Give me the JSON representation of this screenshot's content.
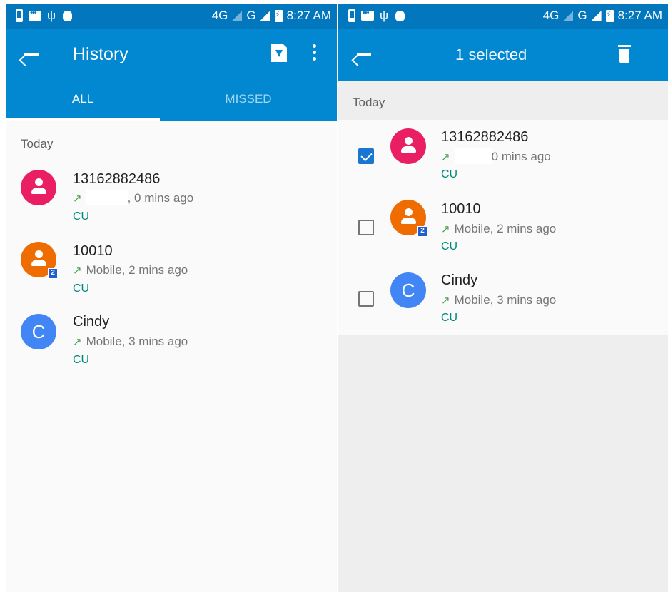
{
  "status_bar": {
    "network": "4G",
    "network2": "G",
    "time": "8:27 AM"
  },
  "left": {
    "title": "History",
    "tabs": [
      {
        "label": "ALL",
        "selected": true
      },
      {
        "label": "MISSED",
        "selected": false
      }
    ],
    "section_header": "Today",
    "entries": [
      {
        "name": "13162882486",
        "detail": ", 0 mins ago",
        "carrier": "CU",
        "avatar": "person",
        "avatar_color": "#e91e63",
        "sim": ""
      },
      {
        "name": "10010",
        "detail": "Mobile, 2 mins ago",
        "carrier": "CU",
        "avatar": "person",
        "avatar_color": "#ef6c00",
        "sim": "2"
      },
      {
        "name": "Cindy",
        "detail": "Mobile, 3 mins ago",
        "carrier": "CU",
        "avatar": "C",
        "avatar_color": "#4285f4",
        "sim": ""
      }
    ]
  },
  "right": {
    "title": "1 selected",
    "section_header": "Today",
    "entries": [
      {
        "name": "13162882486",
        "detail": "0 mins ago",
        "carrier": "CU",
        "checked": true,
        "sim": ""
      },
      {
        "name": "10010",
        "detail": "Mobile, 2 mins ago",
        "carrier": "CU",
        "checked": false,
        "sim": "2"
      },
      {
        "name": "Cindy",
        "detail": "Mobile, 3 mins ago",
        "carrier": "CU",
        "checked": false,
        "avatar": "C",
        "sim": ""
      }
    ]
  },
  "icons": {
    "back": "arrow-back-icon",
    "sim_card": "sim-card-icon",
    "more": "more-vert-icon",
    "delete": "trash-icon",
    "outgoing": "outgoing-call-arrow-icon"
  },
  "colors": {
    "status_bar": "#0277bd",
    "app_bar": "#0288d1",
    "checkbox_checked": "#1976d2",
    "carrier_text": "#00897b",
    "outgoing_arrow": "#43a047"
  }
}
